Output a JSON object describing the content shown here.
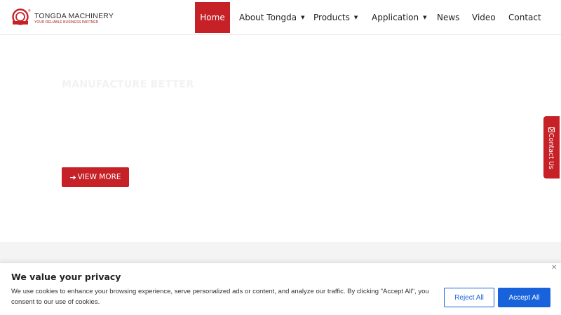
{
  "brand": {
    "name": "TONGDA MACHINERY",
    "tagline": "YOUR RELIABLE BUSINESS PARTNER",
    "color": "#c62127"
  },
  "nav": {
    "items": [
      {
        "label": "Home",
        "active": true
      },
      {
        "label": "About Tongda",
        "dropdown": true
      },
      {
        "label": "Products",
        "dropdown": true
      },
      {
        "label": "Application",
        "dropdown": true
      },
      {
        "label": "News"
      },
      {
        "label": "Video"
      },
      {
        "label": "Contact"
      }
    ]
  },
  "hero": {
    "title": "MANUFACTURE BETTER",
    "button_label": "VIEW MORE",
    "button_icon": "arrow-right-icon"
  },
  "contact_tab": {
    "label": "Contact Us",
    "icon": "mail-icon"
  },
  "cookie": {
    "title": "We value your privacy",
    "text": "We use cookies to enhance your browsing experience, serve personalized ads or content, and analyze our traffic. By clicking \"Accept All\", you consent to our use of cookies.",
    "reject_label": "Reject All",
    "accept_label": "Accept All",
    "close_icon": "close-icon",
    "accent": "#1863dc"
  }
}
